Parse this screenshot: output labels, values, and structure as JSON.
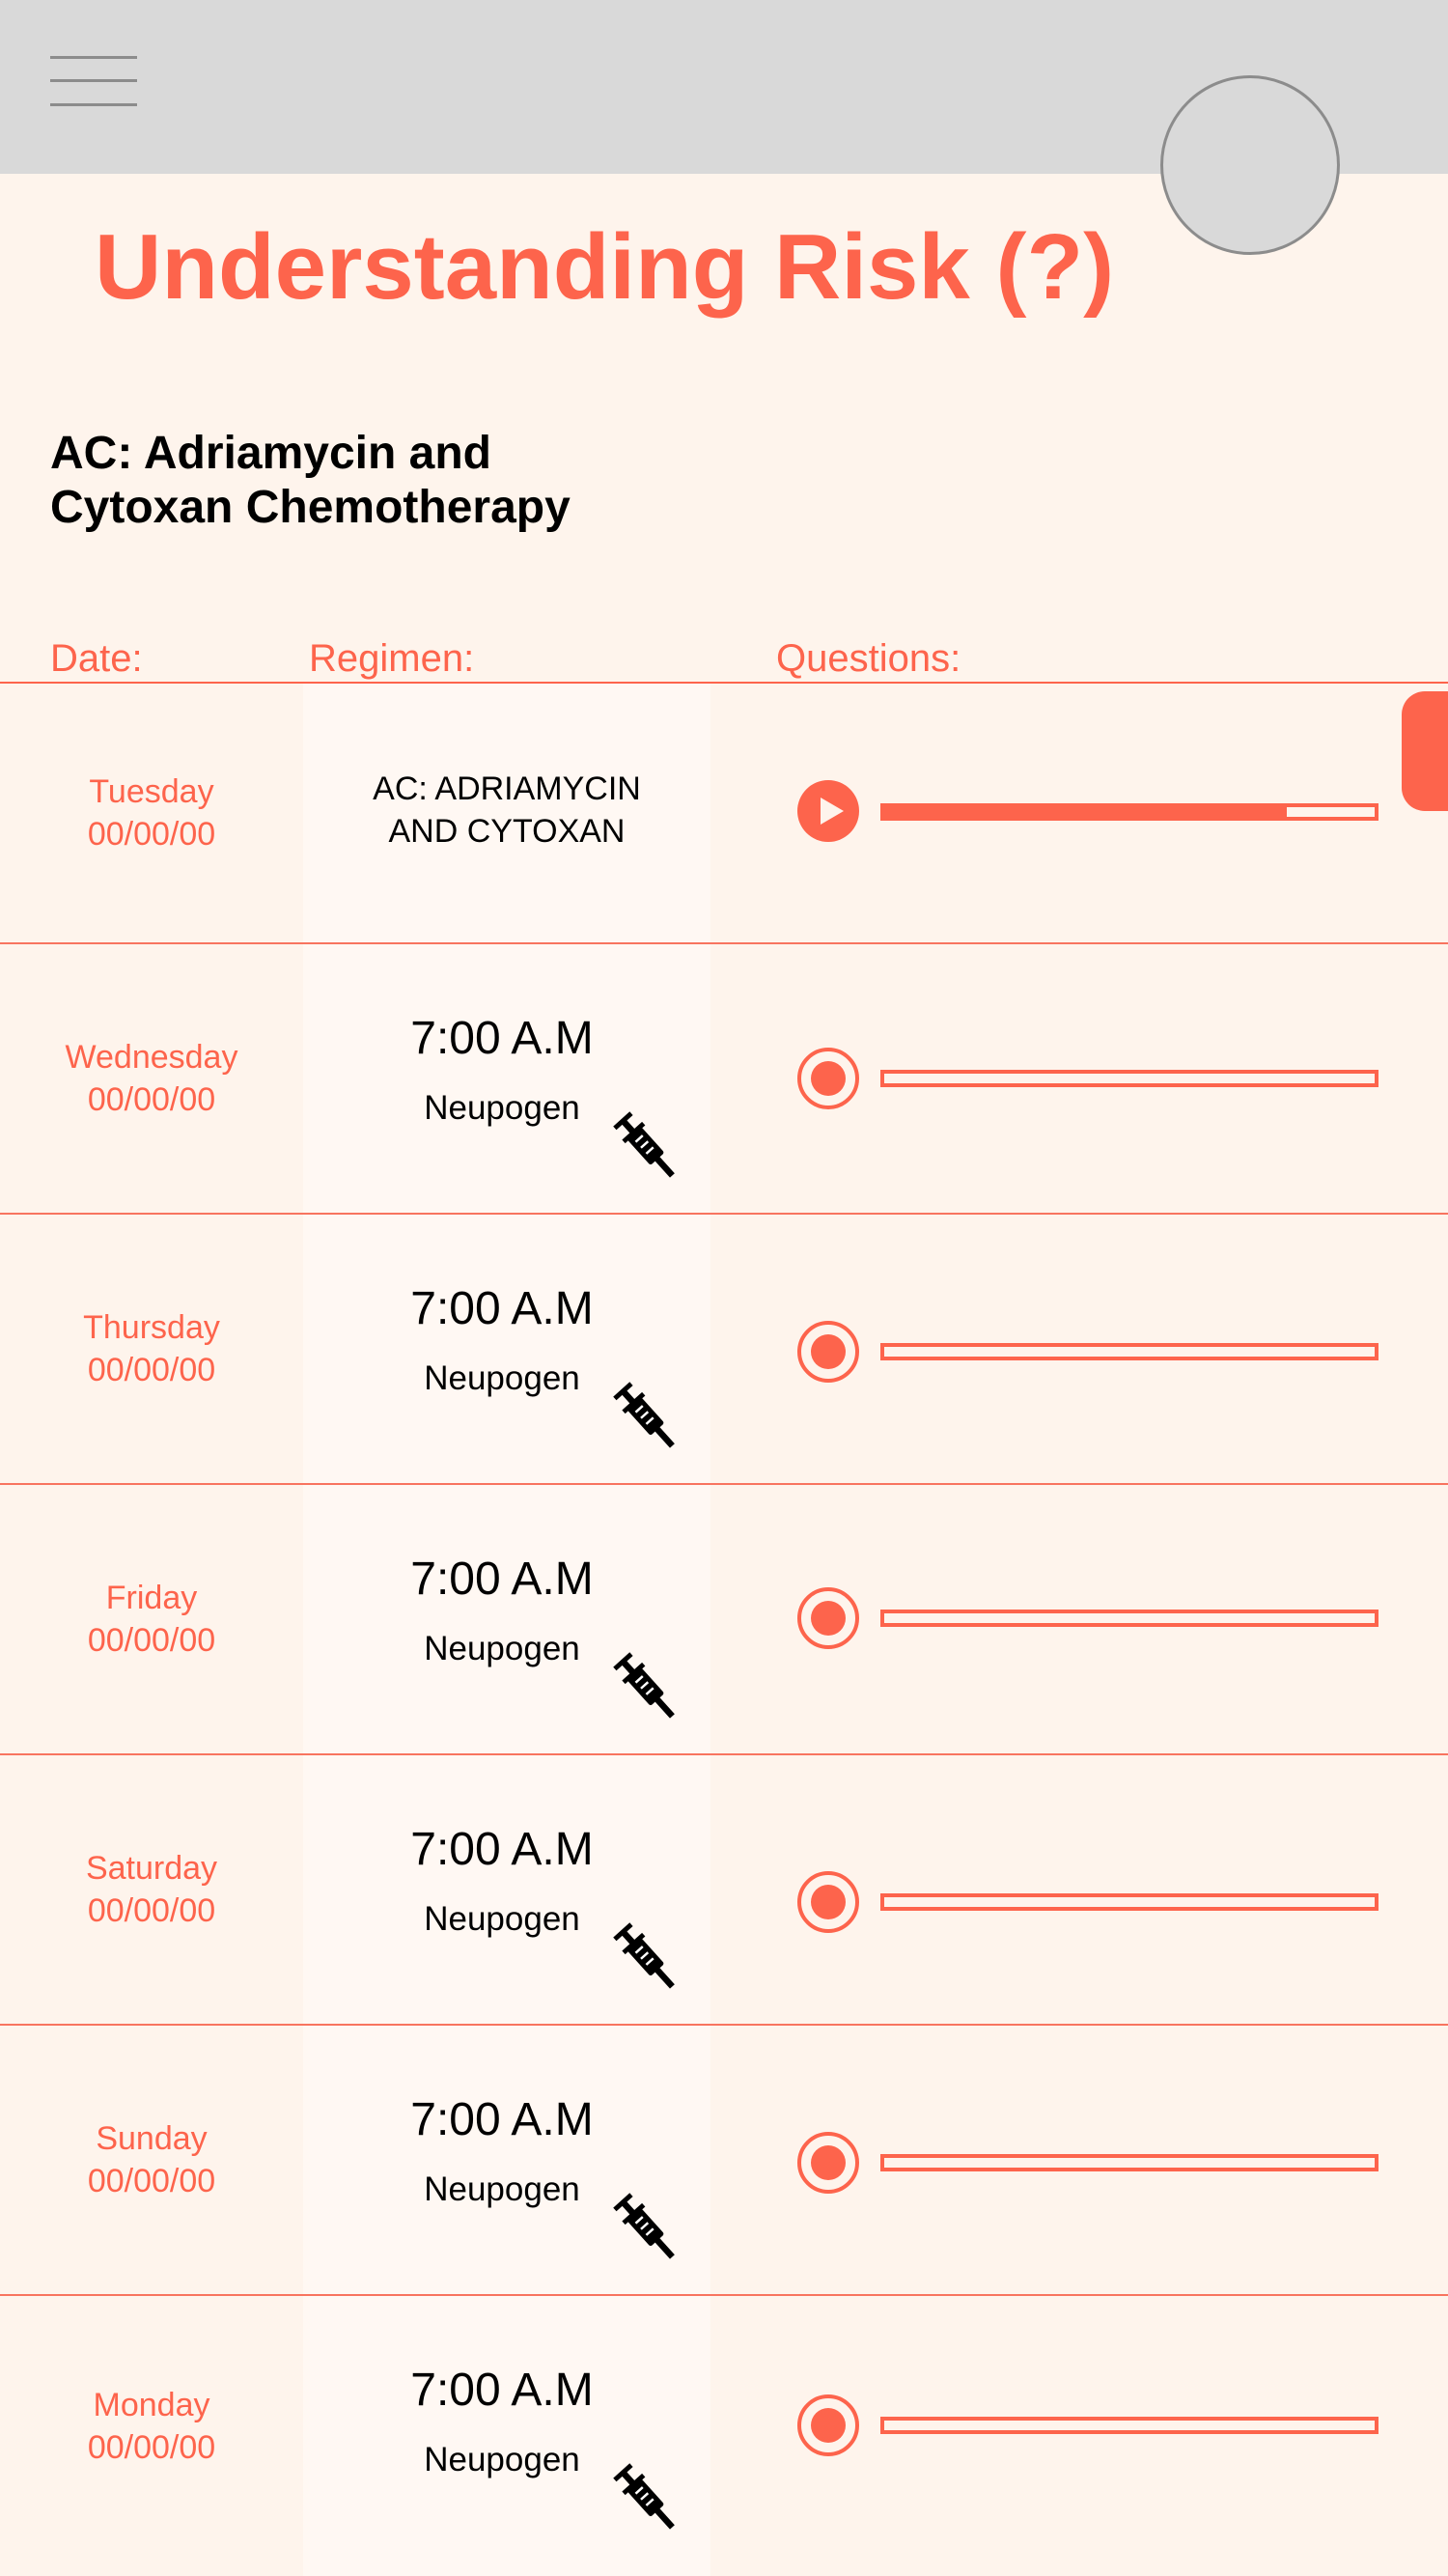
{
  "header": {
    "title": "Understanding Risk (?)",
    "subtitle_line1": "AC: Adriamycin and",
    "subtitle_line2": "Cytoxan Chemotherapy"
  },
  "columns": {
    "date": "Date:",
    "regimen": "Regimen:",
    "questions": "Questions:"
  },
  "rows": [
    {
      "day": "Tuesday",
      "date": "00/00/00",
      "regimen_line1": "AC: ADRIAMYCIN",
      "regimen_line2": "AND CYTOXAN",
      "audio_control": "play",
      "progress": 0.82
    },
    {
      "day": "Wednesday",
      "date": "00/00/00",
      "time": "7:00 A.M",
      "medication": "Neupogen",
      "icon": "syringe-icon",
      "audio_control": "record",
      "progress": 0
    },
    {
      "day": "Thursday",
      "date": "00/00/00",
      "time": "7:00 A.M",
      "medication": "Neupogen",
      "icon": "syringe-icon",
      "audio_control": "record",
      "progress": 0
    },
    {
      "day": "Friday",
      "date": "00/00/00",
      "time": "7:00 A.M",
      "medication": "Neupogen",
      "icon": "syringe-icon",
      "audio_control": "record",
      "progress": 0
    },
    {
      "day": "Saturday",
      "date": "00/00/00",
      "time": "7:00 A.M",
      "medication": "Neupogen",
      "icon": "syringe-icon",
      "audio_control": "record",
      "progress": 0
    },
    {
      "day": "Sunday",
      "date": "00/00/00",
      "time": "7:00 A.M",
      "medication": "Neupogen",
      "icon": "syringe-icon",
      "audio_control": "record",
      "progress": 0
    },
    {
      "day": "Monday",
      "date": "00/00/00",
      "time": "7:00 A.M",
      "medication": "Neupogen",
      "icon": "syringe-icon",
      "audio_control": "record",
      "progress": 0
    }
  ],
  "colors": {
    "accent": "#fd644c",
    "background": "#fef4ec",
    "topbar": "#d9d9d9"
  }
}
